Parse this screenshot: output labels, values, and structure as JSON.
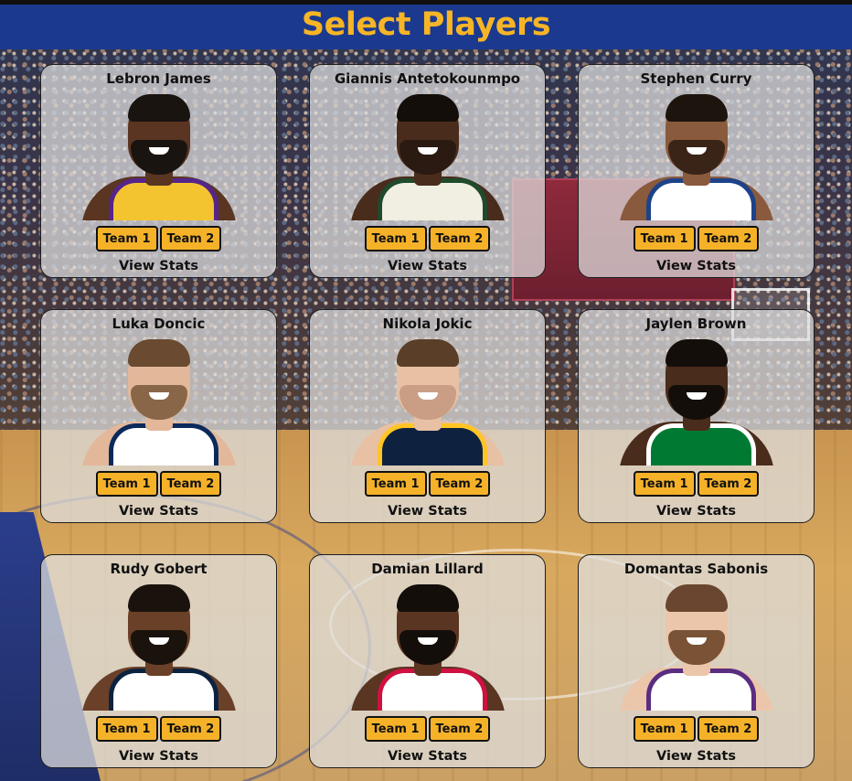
{
  "header": {
    "title": "Select Players"
  },
  "players": [
    {
      "name": "Lebron James",
      "team1": "Team 1",
      "team2": "Team 2",
      "stats": "View Stats",
      "skin": "#5a3522",
      "hair": "#1a1410",
      "beard": "#1a1410",
      "jersey": "#f4c430",
      "trim": "#55258a"
    },
    {
      "name": "Giannis Antetokounmpo",
      "team1": "Team 1",
      "team2": "Team 2",
      "stats": "View Stats",
      "skin": "#4a2c1c",
      "hair": "#140e0a",
      "beard": "#2a1a12",
      "jersey": "#f1eee2",
      "trim": "#1f4a2b"
    },
    {
      "name": "Stephen Curry",
      "team1": "Team 1",
      "team2": "Team 2",
      "stats": "View Stats",
      "skin": "#8a5a3c",
      "hair": "#1e140e",
      "beard": "#3a2418",
      "jersey": "#ffffff",
      "trim": "#1d428a"
    },
    {
      "name": "Luka Doncic",
      "team1": "Team 1",
      "team2": "Team 2",
      "stats": "View Stats",
      "skin": "#e3b89a",
      "hair": "#6a4a30",
      "beard": "#8a6648",
      "jersey": "#ffffff",
      "trim": "#0b2a5c"
    },
    {
      "name": "Nikola Jokic",
      "team1": "Team 1",
      "team2": "Team 2",
      "stats": "View Stats",
      "skin": "#e8c0a4",
      "hair": "#5a3e28",
      "beard": "#c99e84",
      "jersey": "#0e2240",
      "trim": "#fec524"
    },
    {
      "name": "Jaylen Brown",
      "team1": "Team 1",
      "team2": "Team 2",
      "stats": "View Stats",
      "skin": "#4a2c1c",
      "hair": "#140e0a",
      "beard": "#140e0a",
      "jersey": "#007a33",
      "trim": "#ffffff"
    },
    {
      "name": "Rudy Gobert",
      "team1": "Team 1",
      "team2": "Team 2",
      "stats": "View Stats",
      "skin": "#6a4028",
      "hair": "#1a120c",
      "beard": "#1a120c",
      "jersey": "#ffffff",
      "trim": "#0c2340"
    },
    {
      "name": "Damian Lillard",
      "team1": "Team 1",
      "team2": "Team 2",
      "stats": "View Stats",
      "skin": "#5a3522",
      "hair": "#140e0a",
      "beard": "#140e0a",
      "jersey": "#ffffff",
      "trim": "#ce1141"
    },
    {
      "name": "Domantas Sabonis",
      "team1": "Team 1",
      "team2": "Team 2",
      "stats": "View Stats",
      "skin": "#ecc6aa",
      "hair": "#6a4630",
      "beard": "#7a5236",
      "jersey": "#ffffff",
      "trim": "#5a2d81"
    }
  ]
}
